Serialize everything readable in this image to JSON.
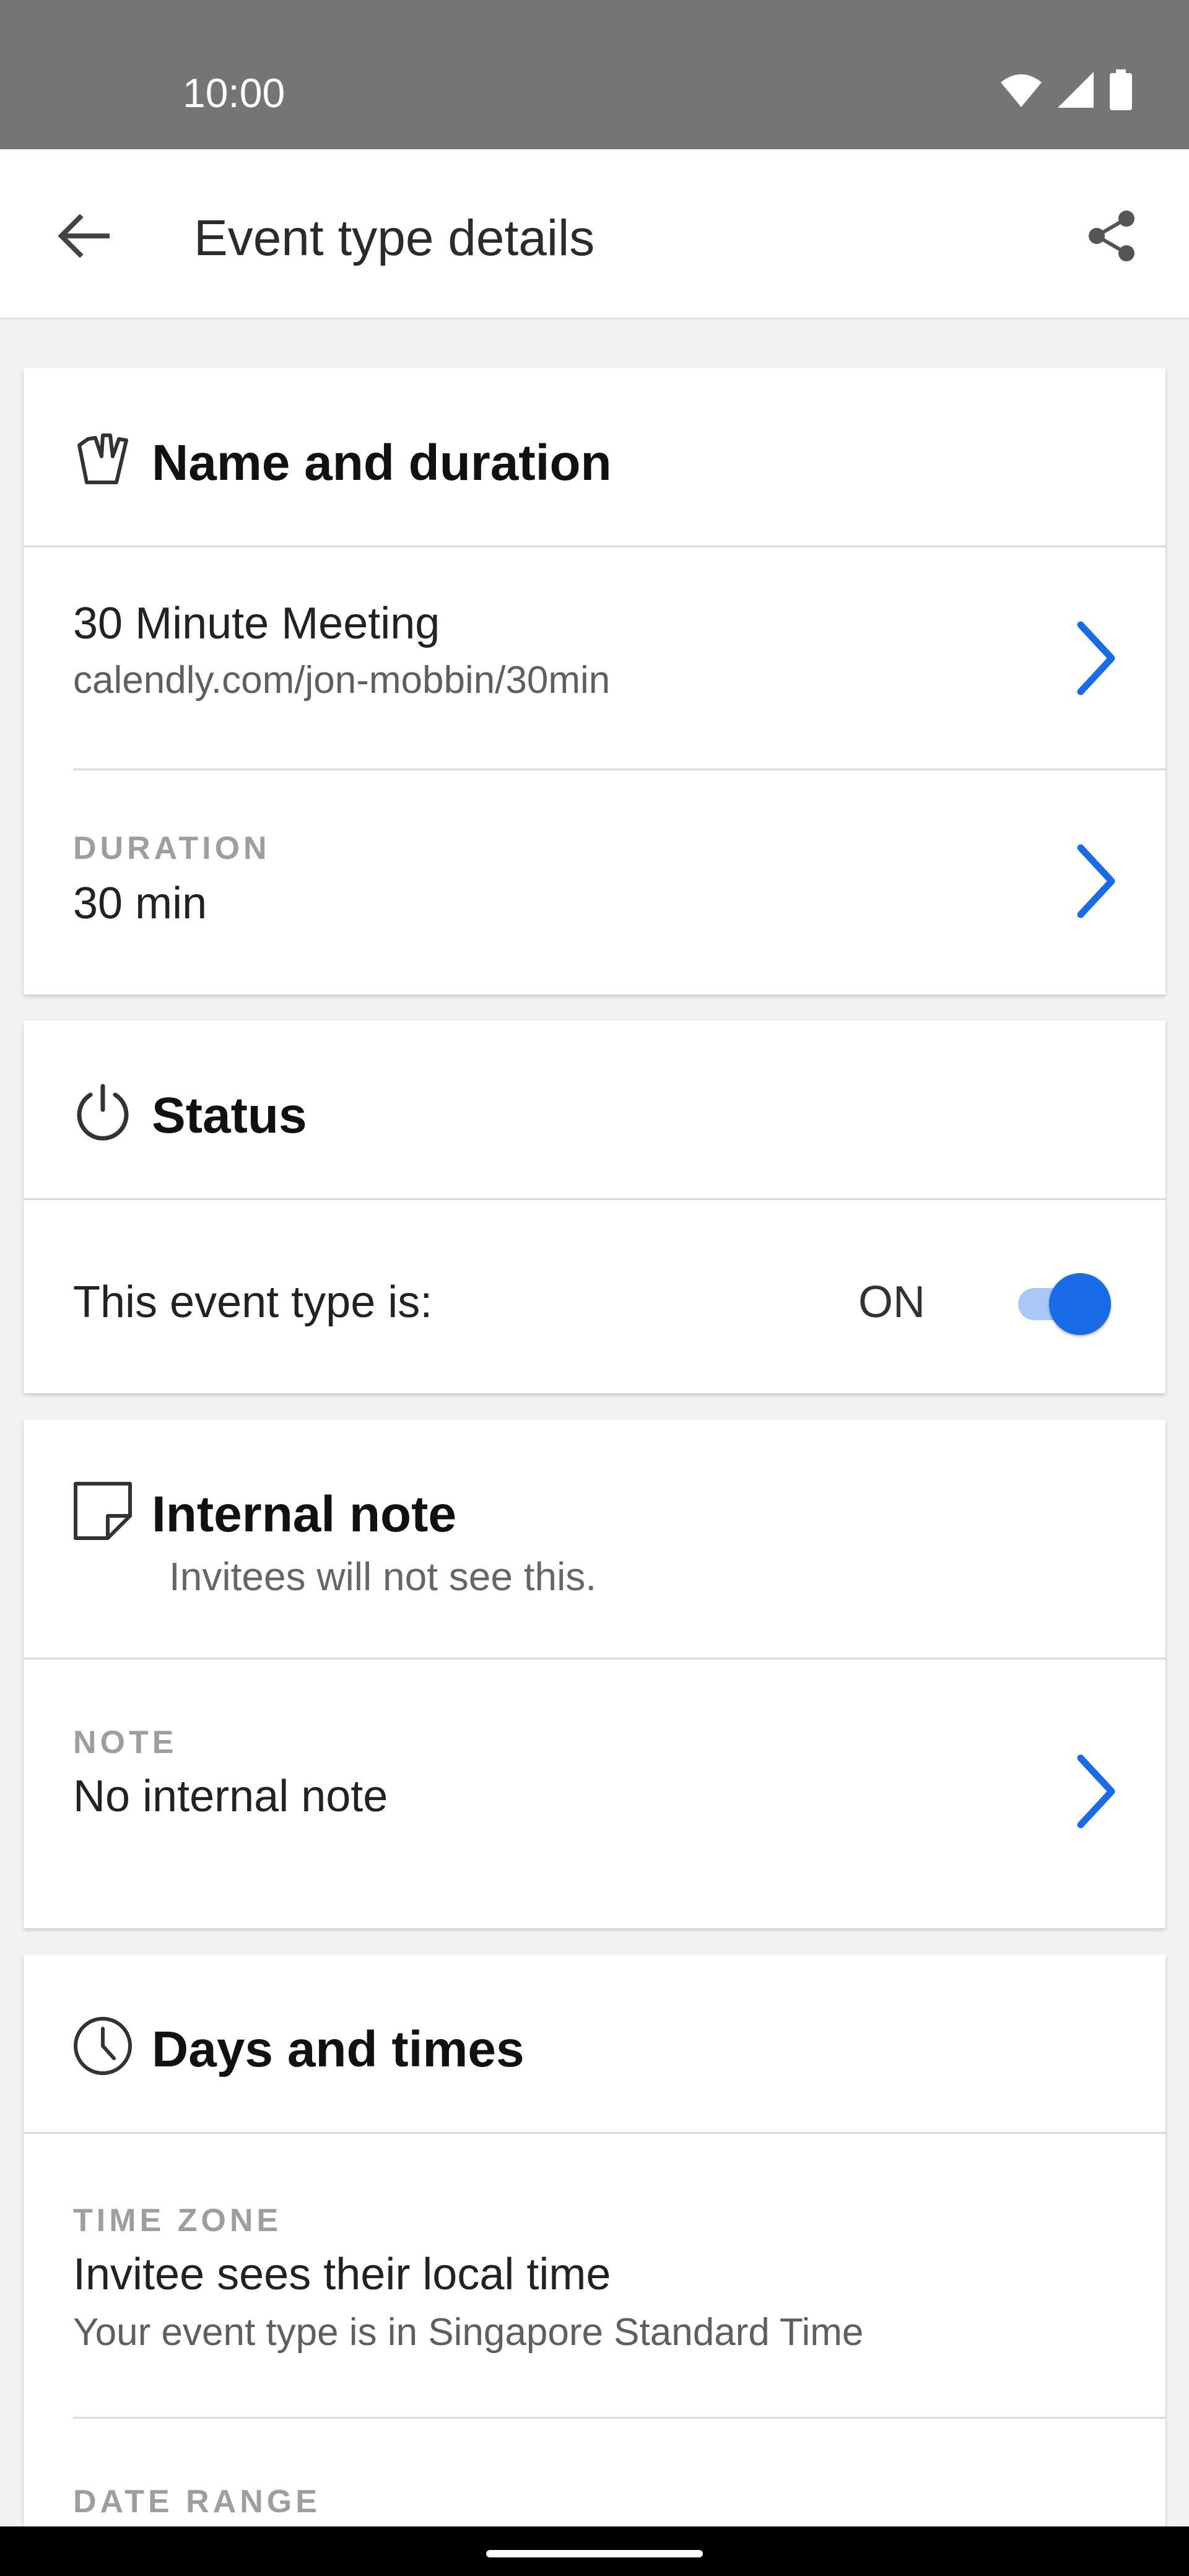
{
  "status_bar": {
    "time": "10:00",
    "icons": [
      "wifi-icon",
      "cellular-signal-icon",
      "battery-icon"
    ]
  },
  "app_bar": {
    "title": "Event type details",
    "back_icon": "arrow-back-icon",
    "share_icon": "share-icon"
  },
  "sections": {
    "name_duration": {
      "title": "Name and duration",
      "icon": "hand-icon",
      "event_name": "30 Minute Meeting",
      "event_url": "calendly.com/jon-mobbin/30min",
      "duration_label": "DURATION",
      "duration_value": "30 min"
    },
    "status": {
      "title": "Status",
      "icon": "power-icon",
      "row_label": "This event type is:",
      "state_text": "ON",
      "toggle_on": true
    },
    "internal_note": {
      "title": "Internal note",
      "subtitle": "Invitees will not see this.",
      "icon": "note-icon",
      "note_label": "NOTE",
      "note_value": "No internal note"
    },
    "days_times": {
      "title": "Days and times",
      "icon": "clock-icon",
      "timezone_label": "TIME ZONE",
      "timezone_value": "Invitee sees their local time",
      "timezone_detail": "Your event type is in Singapore Standard Time",
      "date_range_label": "DATE RANGE"
    }
  },
  "colors": {
    "accent": "#1a6be8",
    "status_bar": "#757575",
    "background": "#f2f2f2"
  }
}
